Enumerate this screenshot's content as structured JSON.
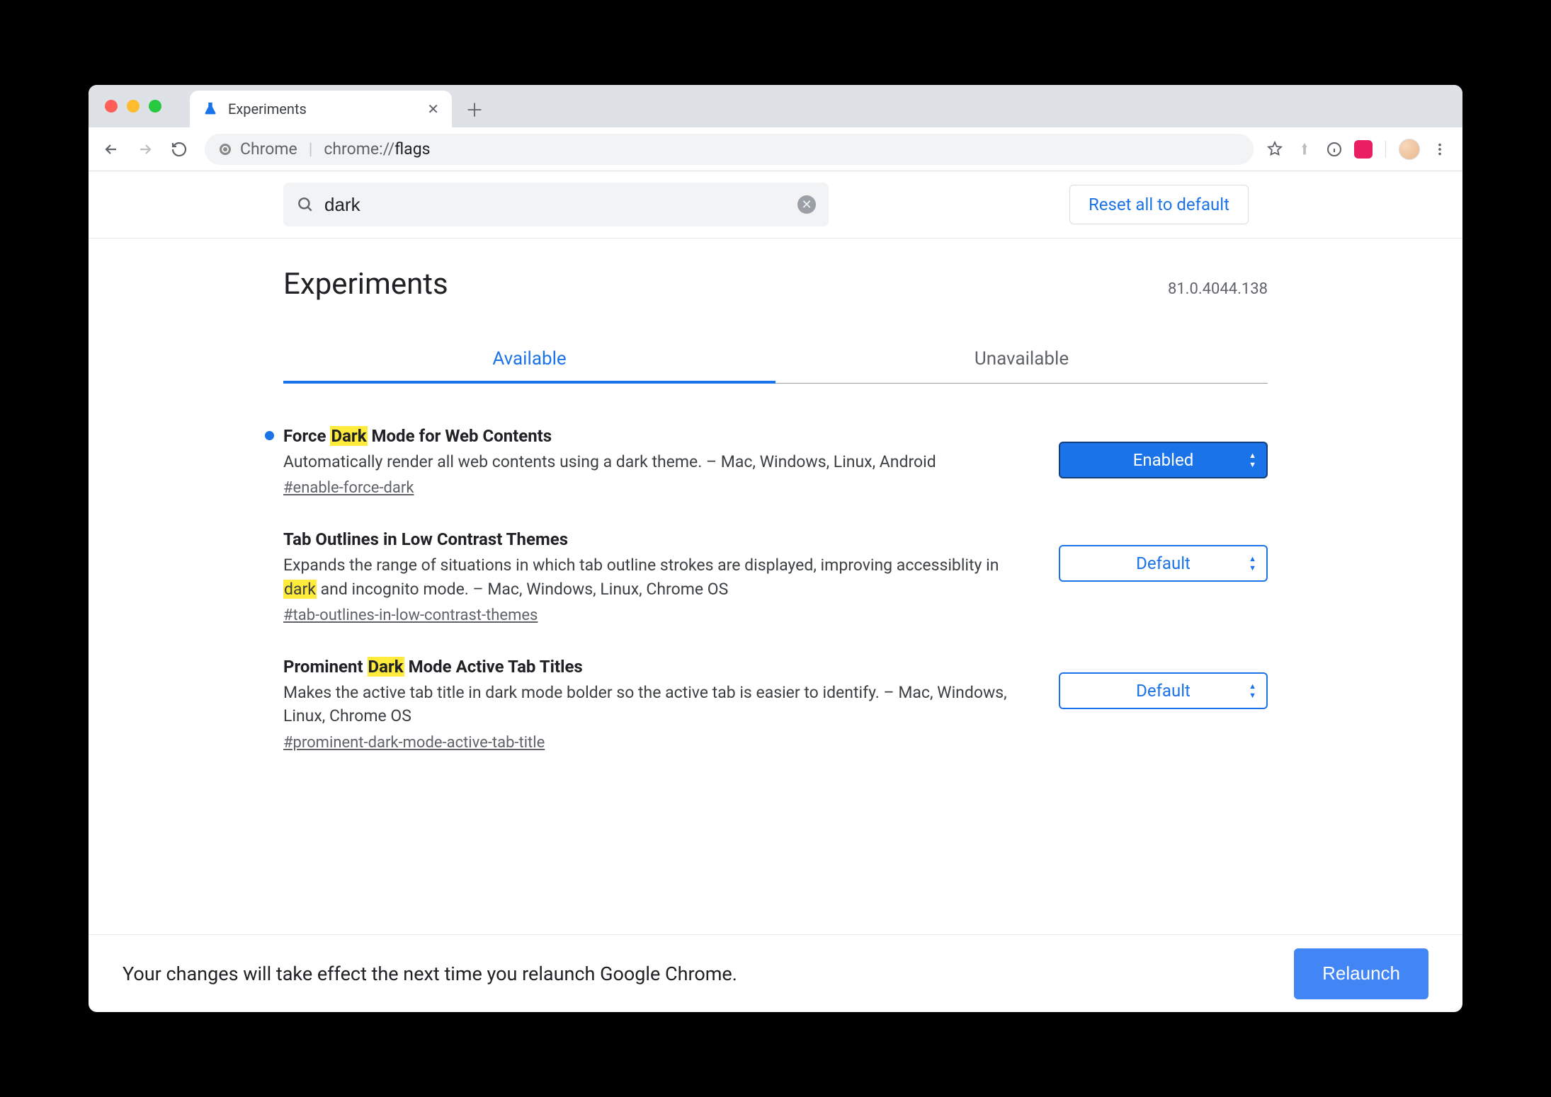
{
  "tab": {
    "title": "Experiments"
  },
  "omnibox": {
    "label": "Chrome",
    "urlPrefix": "chrome://",
    "urlHighlight": "flags"
  },
  "search": {
    "value": "dark"
  },
  "resetButton": "Reset all to default",
  "pageTitle": "Experiments",
  "version": "81.0.4044.138",
  "tabs": {
    "available": "Available",
    "unavailable": "Unavailable"
  },
  "flags": [
    {
      "title_pre": "Force ",
      "title_hi": "Dark",
      "title_post": " Mode for Web Contents",
      "desc_pre": "Automatically render all web contents using a dark theme. – Mac, Windows, Linux, Android",
      "desc_hi": "",
      "desc_post": "",
      "anchor": "#enable-force-dark",
      "select": "Enabled",
      "style": "enabled",
      "modified": true
    },
    {
      "title_pre": "Tab Outlines in Low Contrast Themes",
      "title_hi": "",
      "title_post": "",
      "desc_pre": "Expands the range of situations in which tab outline strokes are displayed, improving accessiblity in ",
      "desc_hi": "dark",
      "desc_post": " and incognito mode. – Mac, Windows, Linux, Chrome OS",
      "anchor": "#tab-outlines-in-low-contrast-themes",
      "select": "Default",
      "style": "default",
      "modified": false
    },
    {
      "title_pre": "Prominent ",
      "title_hi": "Dark",
      "title_post": " Mode Active Tab Titles",
      "desc_pre": "Makes the active tab title in dark mode bolder so the active tab is easier to identify. – Mac, Windows, Linux, Chrome OS",
      "desc_hi": "",
      "desc_post": "",
      "anchor": "#prominent-dark-mode-active-tab-title",
      "select": "Default",
      "style": "default",
      "modified": false
    }
  ],
  "footer": {
    "message": "Your changes will take effect the next time you relaunch Google Chrome.",
    "button": "Relaunch"
  }
}
